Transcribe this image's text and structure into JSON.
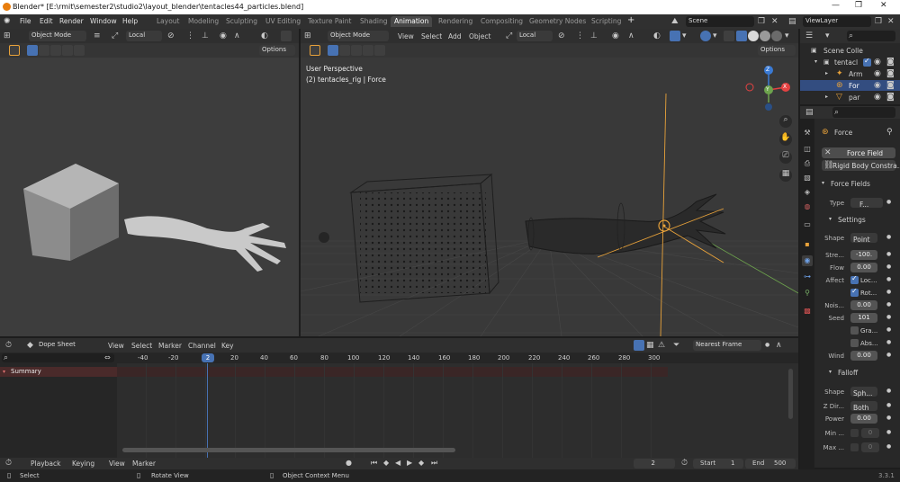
{
  "window": {
    "title": "Blender* [E:\\rmit\\semester2\\studio2\\layout_blender\\tentacles44_particles.blend]",
    "controls": [
      "—",
      "❐",
      "✕"
    ]
  },
  "menu": [
    "File",
    "Edit",
    "Render",
    "Window",
    "Help"
  ],
  "workspaces": [
    "Layout",
    "Modeling",
    "Sculpting",
    "UV Editing",
    "Texture Paint",
    "Shading",
    "Animation",
    "Rendering",
    "Compositing",
    "Geometry Nodes",
    "Scripting"
  ],
  "active_workspace": "Animation",
  "add_workspace": "+",
  "scene": {
    "label": "Scene"
  },
  "view_layer": {
    "label": "ViewLayer"
  },
  "left_viewport": {
    "mode": "Object Mode",
    "orientation": "Local",
    "options": "Options"
  },
  "right_viewport": {
    "mode": "Object Mode",
    "menus": [
      "View",
      "Select",
      "Add",
      "Object"
    ],
    "orientation": "Local",
    "options": "Options",
    "overlay_title": "User Perspective",
    "overlay_subtitle": "(2) tentacles_rig | Force",
    "gizmo": {
      "x": "X",
      "y": "Y",
      "z": "Z"
    }
  },
  "outliner": {
    "rows": [
      {
        "label": "Scene Colle"
      },
      {
        "label": "tentacl"
      },
      {
        "label": "Arm"
      },
      {
        "label": "For"
      },
      {
        "label": "par"
      }
    ]
  },
  "properties": {
    "object_name": "Force",
    "force_field_button": "Force Field",
    "rigid_body_button": "Rigid Body Constra...",
    "force_fields_panel": "Force Fields",
    "type_label": "Type",
    "type_value": "F...",
    "settings_panel": "Settings",
    "shape_label": "Shape",
    "shape_value": "Point",
    "strength_label": "Stre...",
    "strength_value": "-100.",
    "flow_label": "Flow",
    "flow_value": "0.00",
    "affect_label": "Affect",
    "affect_location": "Loc...",
    "affect_rotation": "Rot...",
    "noise_label": "Nois...",
    "noise_value": "0.00",
    "seed_label": "Seed",
    "seed_value": "101",
    "gravity_label": "Gra...",
    "absorption_label": "Abs...",
    "wind_label": "Wind",
    "wind_value": "0.00",
    "falloff_panel": "Falloff",
    "falloff_shape_label": "Shape",
    "falloff_shape_value": "Sph...",
    "zdir_label": "Z Dir...",
    "zdir_value": "Both",
    "power_label": "Power",
    "power_value": "0.00",
    "min_label": "Min ...",
    "min_value": "0",
    "max_label": "Max ...",
    "max_value": "0"
  },
  "dopesheet": {
    "editor": "Dope Sheet",
    "menus": [
      "View",
      "Select",
      "Marker",
      "Channel",
      "Key"
    ],
    "snapping": "Nearest Frame",
    "summary": "Summary",
    "frame_ticks": [
      "-40",
      "-20",
      "20",
      "40",
      "60",
      "80",
      "100",
      "120",
      "140",
      "160",
      "180",
      "200",
      "220",
      "240",
      "260",
      "280",
      "300"
    ],
    "current_frame_badge": "2"
  },
  "playback": {
    "menus": [
      "Playback",
      "Keying",
      "View",
      "Marker"
    ],
    "current_frame": "2",
    "start_label": "Start",
    "start_value": "1",
    "end_label": "End",
    "end_value": "500"
  },
  "status": {
    "select": "Select",
    "rotate": "Rotate View",
    "context": "Object Context Menu",
    "version": "3.3.1"
  },
  "colors": {
    "accent_blue": "#4772b3",
    "origin_orange": "#e8a23a",
    "axis_x": "#e44242",
    "axis_y": "#6da34d",
    "axis_z": "#3a7ad4",
    "playhead": "#4772b3"
  }
}
